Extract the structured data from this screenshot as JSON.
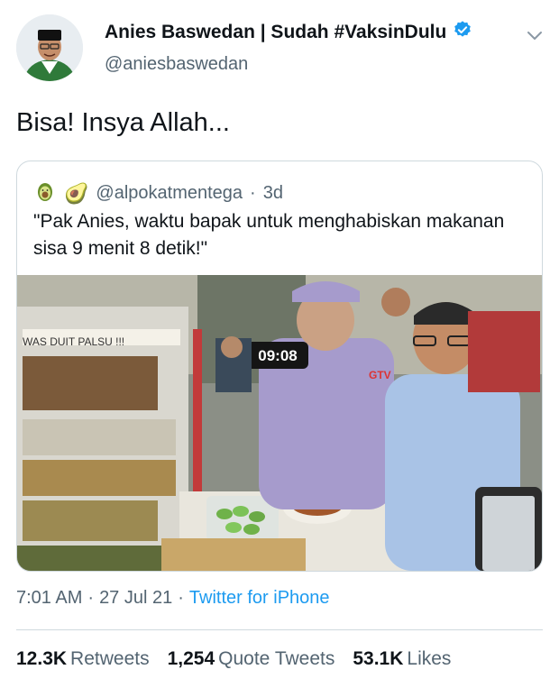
{
  "author": {
    "display_name": "Anies Baswedan | Sudah #VaksinDulu",
    "handle": "@aniesbaswedan",
    "verified_icon": "verified-badge-icon"
  },
  "tweet": {
    "text": "Bisa! Insya Allah...",
    "time": "7:01 AM",
    "date": "27 Jul 21",
    "source": "Twitter for iPhone"
  },
  "quote": {
    "emoji": "🥑",
    "handle": "@alpokatmentega",
    "age": "3d",
    "text": "\"Pak Anies, waktu bapak untuk menghabiskan makanan sisa 9 menit 8 detik!\"",
    "media": {
      "timer": "09:08",
      "sign_text": "WAS DUIT PALSU !!!",
      "logo": "GTV"
    }
  },
  "stats": {
    "retweets_num": "12.3K",
    "retweets_label": "Retweets",
    "quotes_num": "1,254",
    "quotes_label": "Quote Tweets",
    "likes_num": "53.1K",
    "likes_label": "Likes"
  },
  "colors": {
    "accent": "#1d9bf0",
    "secondary_text": "#536471",
    "border": "#cfd9de"
  }
}
